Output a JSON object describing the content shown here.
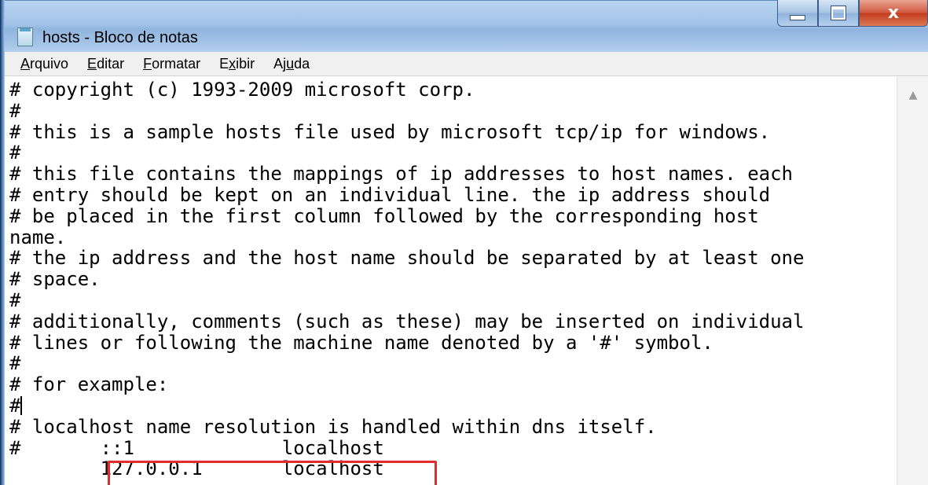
{
  "window": {
    "title": "hosts - Bloco de notas",
    "close_glyph": "x"
  },
  "menu": [
    {
      "pre": "",
      "key": "A",
      "post": "rquivo"
    },
    {
      "pre": "",
      "key": "E",
      "post": "ditar"
    },
    {
      "pre": "",
      "key": "F",
      "post": "ormatar"
    },
    {
      "pre": "E",
      "key": "x",
      "post": "ibir"
    },
    {
      "pre": "Aj",
      "key": "u",
      "post": "da"
    }
  ],
  "file": {
    "lines": [
      "# copyright (c) 1993-2009 microsoft corp.",
      "#",
      "# this is a sample hosts file used by microsoft tcp/ip for windows.",
      "#",
      "# this file contains the mappings of ip addresses to host names. each",
      "# entry should be kept on an individual line. the ip address should",
      "# be placed in the first column followed by the corresponding host",
      "name.",
      "# the ip address and the host name should be separated by at least one",
      "# space.",
      "#",
      "# additionally, comments (such as these) may be inserted on individual",
      "# lines or following the machine name denoted by a '#' symbol.",
      "#",
      "# for example:",
      "#",
      "# localhost name resolution is handled within dns itself.",
      "#       ::1             localhost",
      "        127.0.0.1       localhost"
    ],
    "caret_line_index": 15,
    "highlighted_line_index": 18
  },
  "colors": {
    "highlight_border": "#e32b2b",
    "close_button": "#c23a1c"
  },
  "icons": [
    "notepad-icon",
    "minimize-icon",
    "maximize-icon",
    "close-icon",
    "scroll-up-arrow-icon"
  ]
}
